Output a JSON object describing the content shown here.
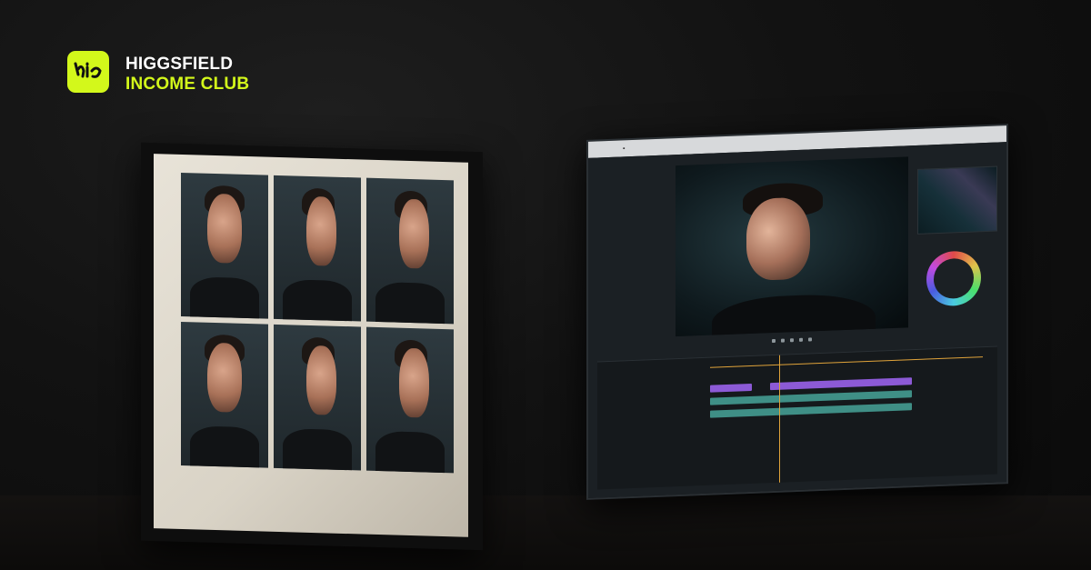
{
  "brand": {
    "name": "HIGGSFIELD",
    "subtitle": "INCOME CLUB",
    "logo_icon": "hic-monogram-icon",
    "accent_color": "#d3f81b"
  },
  "frame": {
    "photos": [
      {
        "view": "front"
      },
      {
        "view": "three-quarter"
      },
      {
        "view": "profile"
      },
      {
        "view": "front"
      },
      {
        "view": "three-quarter"
      },
      {
        "view": "profile"
      }
    ]
  },
  "monitor": {
    "app_icon": "video-editor-icon",
    "viewer_subject": "portrait",
    "timeline_clip_colors": [
      "#8c5ad6",
      "#3f8f86"
    ]
  }
}
